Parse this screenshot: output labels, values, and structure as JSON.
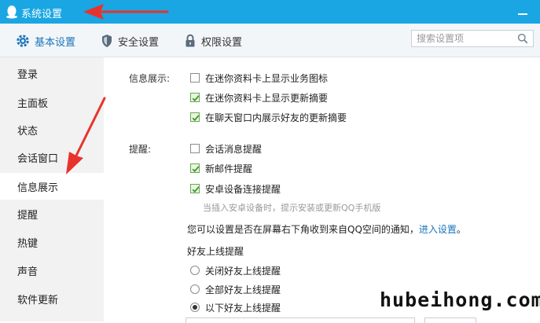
{
  "window": {
    "title": "系统设置",
    "icon": "qq-penguin-icon"
  },
  "toolbar": {
    "tabs": [
      {
        "label": "基本设置",
        "icon": "gear-icon",
        "active": true
      },
      {
        "label": "安全设置",
        "icon": "shield-icon",
        "active": false
      },
      {
        "label": "权限设置",
        "icon": "lock-icon",
        "active": false
      }
    ],
    "search_placeholder": "搜索设置项"
  },
  "sidebar": {
    "items": [
      {
        "label": "登录"
      },
      {
        "label": "主面板"
      },
      {
        "label": "状态"
      },
      {
        "label": "会话窗口"
      },
      {
        "label": "信息展示",
        "active": true
      },
      {
        "label": "提醒"
      },
      {
        "label": "热键"
      },
      {
        "label": "声音"
      },
      {
        "label": "软件更新"
      }
    ]
  },
  "content": {
    "info_display": {
      "label": "信息展示:",
      "options": [
        {
          "label": "在迷你资料卡上显示业务图标",
          "checked": false
        },
        {
          "label": "在迷你资料卡上显示更新摘要",
          "checked": true
        },
        {
          "label": "在聊天窗口内展示好友的更新摘要",
          "checked": true
        }
      ]
    },
    "reminder": {
      "label": "提醒:",
      "options": [
        {
          "label": "会话消息提醒",
          "checked": false
        },
        {
          "label": "新邮件提醒",
          "checked": true
        },
        {
          "label": "安卓设备连接提醒",
          "checked": true
        }
      ],
      "hint": "当插入安卓设备时，提示安装或更新QQ手机版"
    },
    "qzone_notice": {
      "text": "您可以设置是否在屏幕右下角收到来自QQ空间的通知，",
      "link": "进入设置",
      "tail": "。"
    },
    "friend_online": {
      "label": "好友上线提醒",
      "options": [
        {
          "label": "关闭好友上线提醒",
          "checked": false
        },
        {
          "label": "全部好友上线提醒",
          "checked": false
        },
        {
          "label": "以下好友上线提醒",
          "checked": true
        }
      ]
    }
  },
  "watermark": "hubeihong.com",
  "colors": {
    "titlebar": "#19a6e3",
    "accent": "#1b75bb",
    "annotation_arrow": "#e8332c",
    "check": "#3c9a2e"
  }
}
